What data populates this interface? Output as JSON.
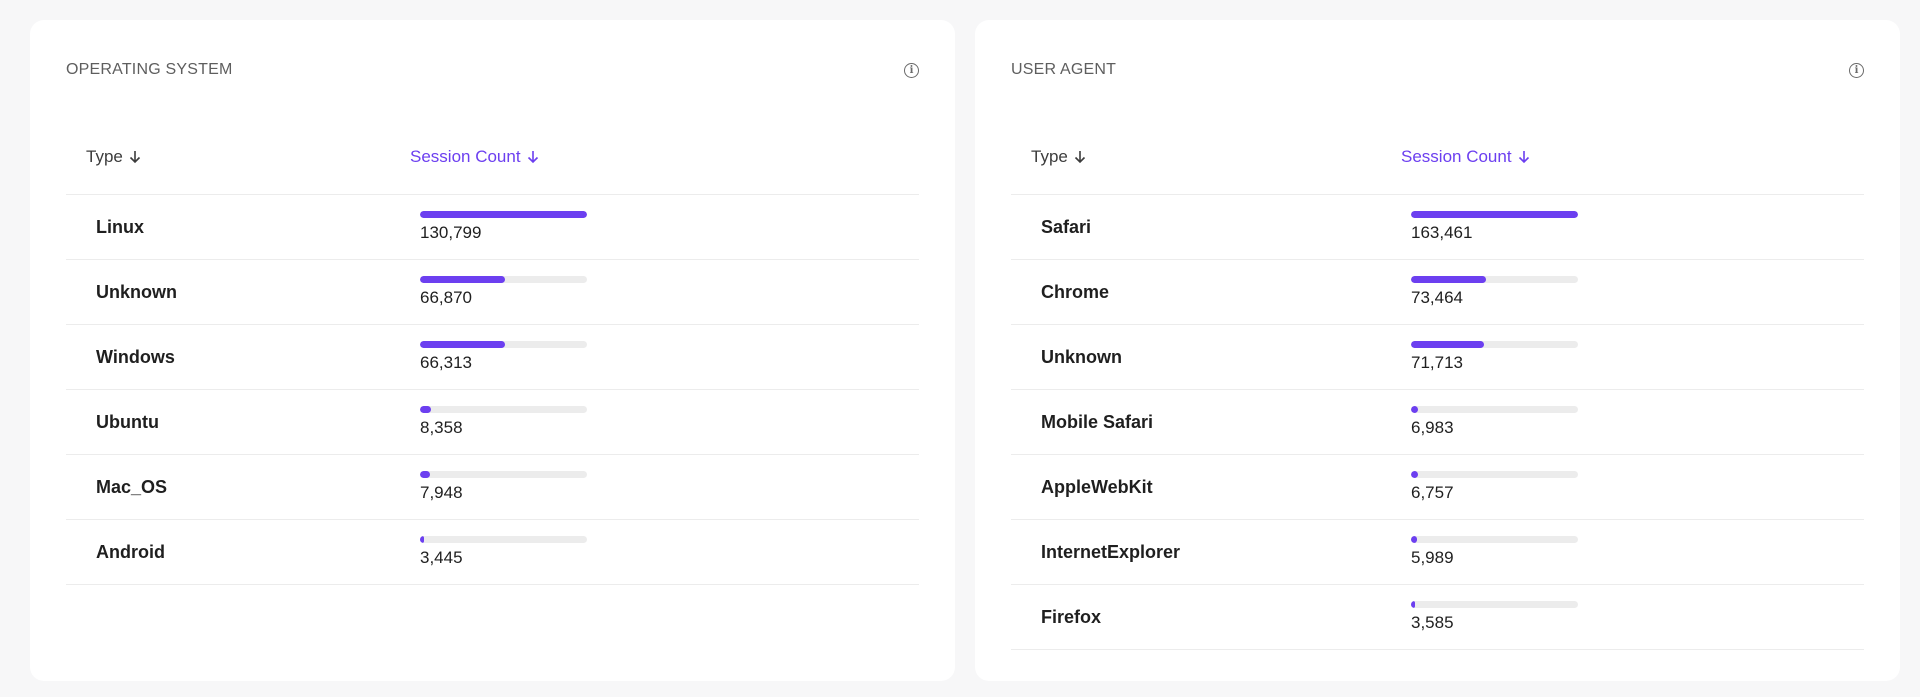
{
  "colors": {
    "accent": "#6c3ff0",
    "track": "#ececec",
    "card_bg": "#ffffff",
    "page_bg": "#f7f7f8"
  },
  "os_panel": {
    "title": "OPERATING SYSTEM",
    "info_icon": "info-icon",
    "col_type": "Type",
    "col_count": "Session Count",
    "sort_icon": "arrow-down-icon",
    "rows": [
      {
        "name": "Linux",
        "count": "130,799",
        "value": 130799
      },
      {
        "name": "Unknown",
        "count": "66,870",
        "value": 66870
      },
      {
        "name": "Windows",
        "count": "66,313",
        "value": 66313
      },
      {
        "name": "Ubuntu",
        "count": "8,358",
        "value": 8358
      },
      {
        "name": "Mac_OS",
        "count": "7,948",
        "value": 7948
      },
      {
        "name": "Android",
        "count": "3,445",
        "value": 3445
      }
    ]
  },
  "ua_panel": {
    "title": "USER AGENT",
    "info_icon": "info-icon",
    "col_type": "Type",
    "col_count": "Session Count",
    "sort_icon": "arrow-down-icon",
    "rows": [
      {
        "name": "Safari",
        "count": "163,461",
        "value": 163461
      },
      {
        "name": "Chrome",
        "count": "73,464",
        "value": 73464
      },
      {
        "name": "Unknown",
        "count": "71,713",
        "value": 71713
      },
      {
        "name": "Mobile Safari",
        "count": "6,983",
        "value": 6983
      },
      {
        "name": "AppleWebKit",
        "count": "6,757",
        "value": 6757
      },
      {
        "name": "InternetExplorer",
        "count": "5,989",
        "value": 5989
      },
      {
        "name": "Firefox",
        "count": "3,585",
        "value": 3585
      }
    ]
  }
}
